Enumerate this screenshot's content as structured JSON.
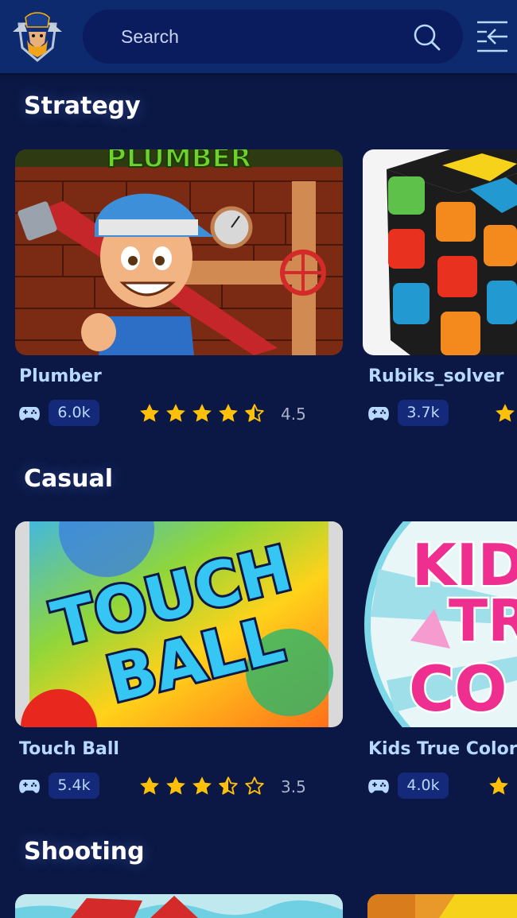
{
  "header": {
    "search_placeholder": "Search",
    "icons": {
      "logo": "viking-mascot-logo",
      "search": "search-icon",
      "menu": "menu-collapse-icon"
    }
  },
  "colors": {
    "background": "#0b1845",
    "header": "#0d2a6e",
    "star": "#ffc107",
    "title": "#b7d9ff",
    "badge": "#15297a"
  },
  "sections": [
    {
      "title": "Strategy",
      "games": [
        {
          "title": "Plumber",
          "plays": "6.0k",
          "rating": "4.5",
          "stars": 4.5
        },
        {
          "title": "Rubiks_solver",
          "plays": "3.7k",
          "rating": "",
          "stars": 1
        }
      ]
    },
    {
      "title": "Casual",
      "games": [
        {
          "title": "Touch Ball",
          "plays": "5.4k",
          "rating": "3.5",
          "stars": 3.5,
          "art_text": [
            "TOUCH",
            "BALL"
          ]
        },
        {
          "title": "Kids True Color",
          "plays": "4.0k",
          "rating": "",
          "stars": 1,
          "art_text": [
            "KID",
            "TR",
            "CO"
          ]
        }
      ]
    },
    {
      "title": "Shooting",
      "games": []
    }
  ]
}
